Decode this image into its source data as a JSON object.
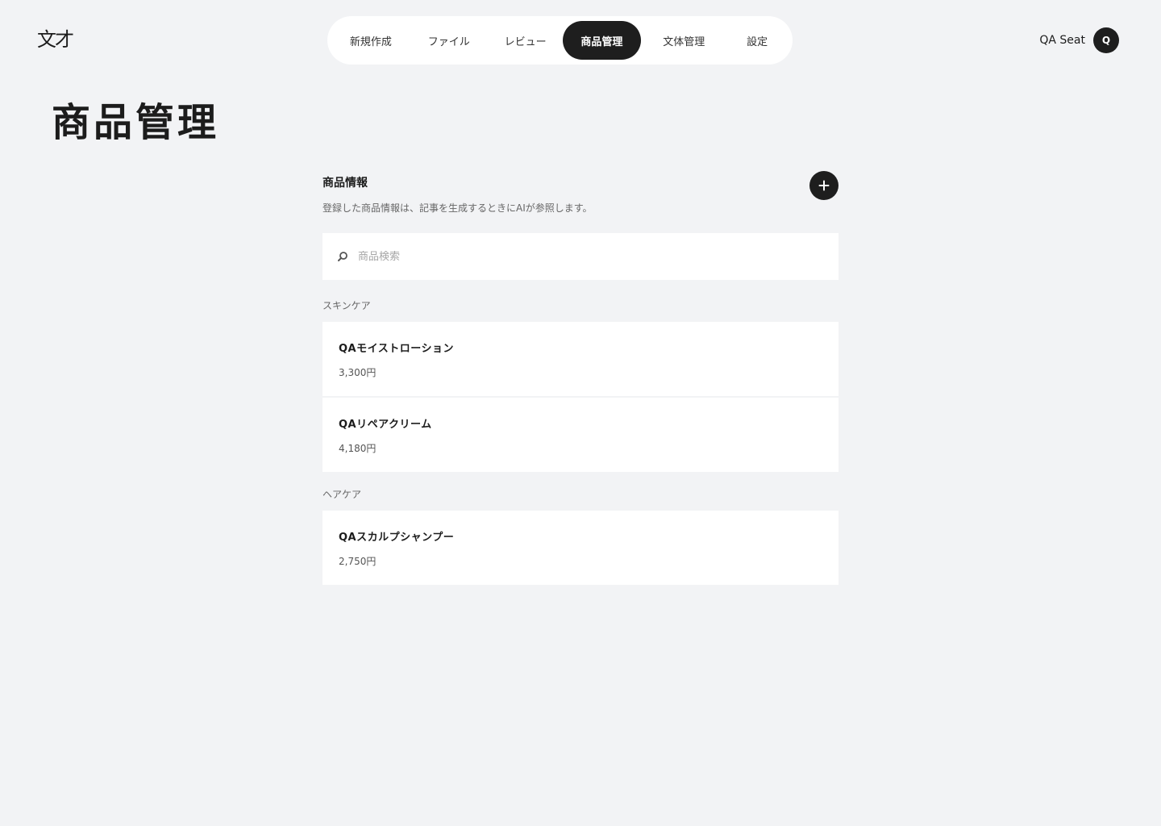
{
  "header": {
    "logo_text": "文才",
    "account_name": "QA Seat",
    "avatar_initial": "Q"
  },
  "nav": {
    "items": [
      {
        "label": "新規作成",
        "active": false
      },
      {
        "label": "ファイル",
        "active": false
      },
      {
        "label": "レビュー",
        "active": false
      },
      {
        "label": "商品管理",
        "active": true
      },
      {
        "label": "文体管理",
        "active": false
      },
      {
        "label": "設定",
        "active": false
      }
    ]
  },
  "page": {
    "title": "商品管理"
  },
  "section": {
    "title": "商品情報",
    "description": "登録した商品情報は、記事を生成するときにAIが参照します。",
    "add_icon": "plus-icon"
  },
  "search": {
    "placeholder": "商品検索",
    "value": "",
    "icon": "search-icon"
  },
  "groups": [
    {
      "label": "スキンケア",
      "products": [
        {
          "name": "QAモイストローション",
          "price": "3,300円"
        },
        {
          "name": "QAリペアクリーム",
          "price": "4,180円"
        }
      ]
    },
    {
      "label": "ヘアケア",
      "products": [
        {
          "name": "QAスカルプシャンプー",
          "price": "2,750円"
        }
      ]
    }
  ],
  "colors": {
    "background": "#f2f3f5",
    "surface": "#ffffff",
    "accent": "#1e1e1e"
  }
}
